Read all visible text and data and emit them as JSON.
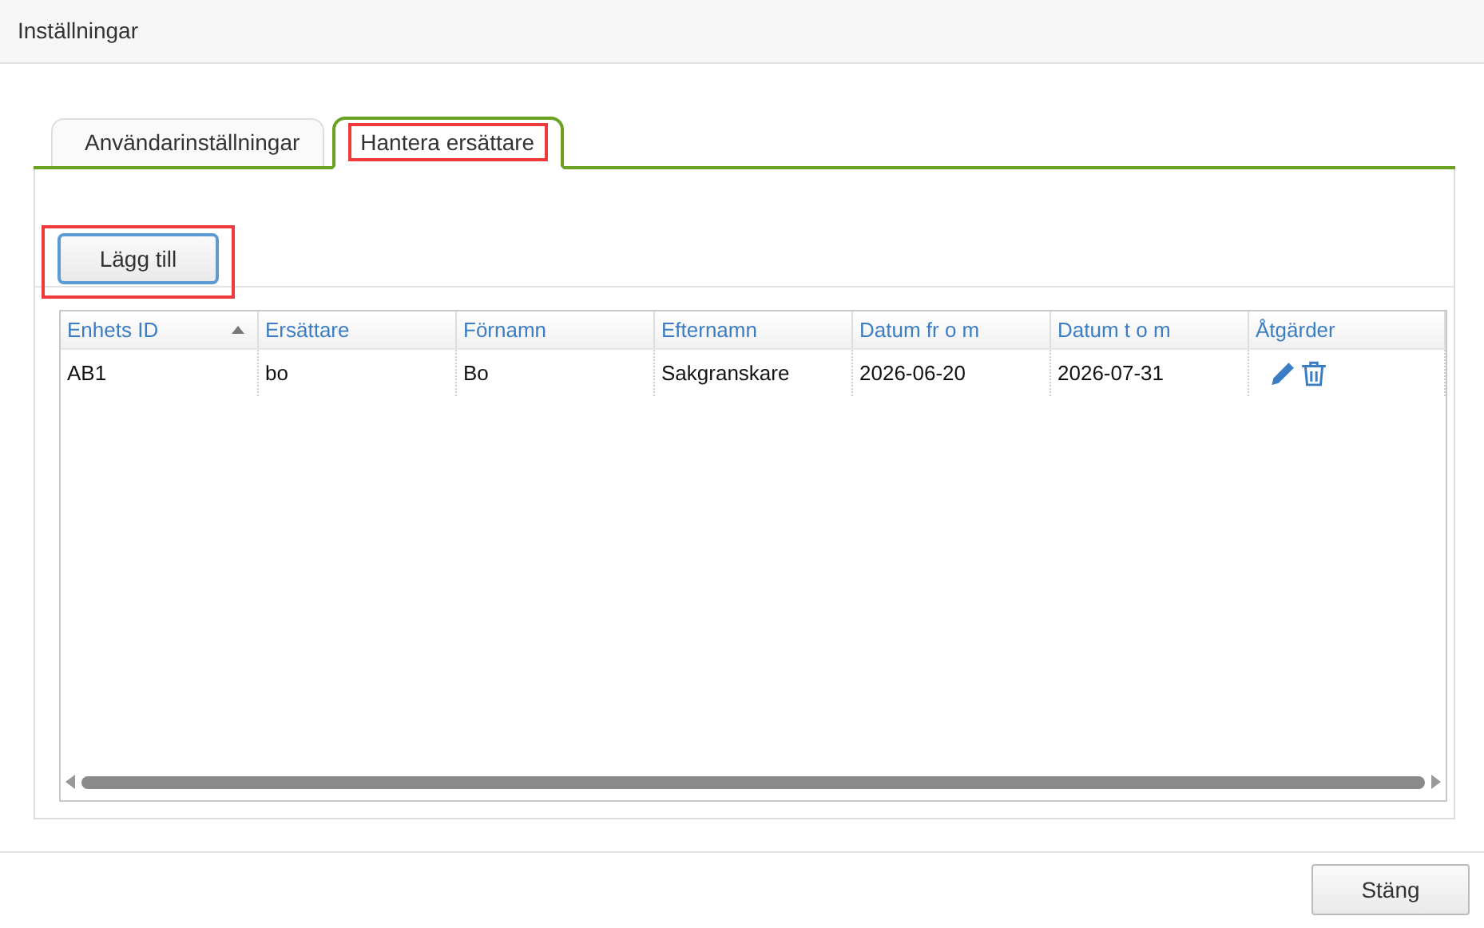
{
  "window": {
    "title": "Inställningar"
  },
  "tabs": [
    {
      "label": "Användarinställningar",
      "selected": false,
      "highlighted": false
    },
    {
      "label": "Hantera ersättare",
      "selected": true,
      "highlighted": true
    }
  ],
  "add_button": {
    "label": "Lägg till",
    "highlighted": true
  },
  "table": {
    "columns": [
      {
        "label": "Enhets ID",
        "sorted": true
      },
      {
        "label": "Ersättare",
        "sorted": false
      },
      {
        "label": "Förnamn",
        "sorted": false
      },
      {
        "label": "Efternamn",
        "sorted": false
      },
      {
        "label": "Datum fr o m",
        "sorted": false
      },
      {
        "label": "Datum t o m",
        "sorted": false
      },
      {
        "label": "Åtgärder",
        "sorted": false
      }
    ],
    "rows": [
      {
        "cells": [
          "AB1",
          "bo",
          "Bo",
          "Sakgranskare",
          "2026-06-20",
          "2026-07-31"
        ],
        "actions": [
          {
            "kind": "edit"
          },
          {
            "kind": "delete"
          }
        ]
      }
    ]
  },
  "footer": {
    "close_button": "Stäng"
  }
}
